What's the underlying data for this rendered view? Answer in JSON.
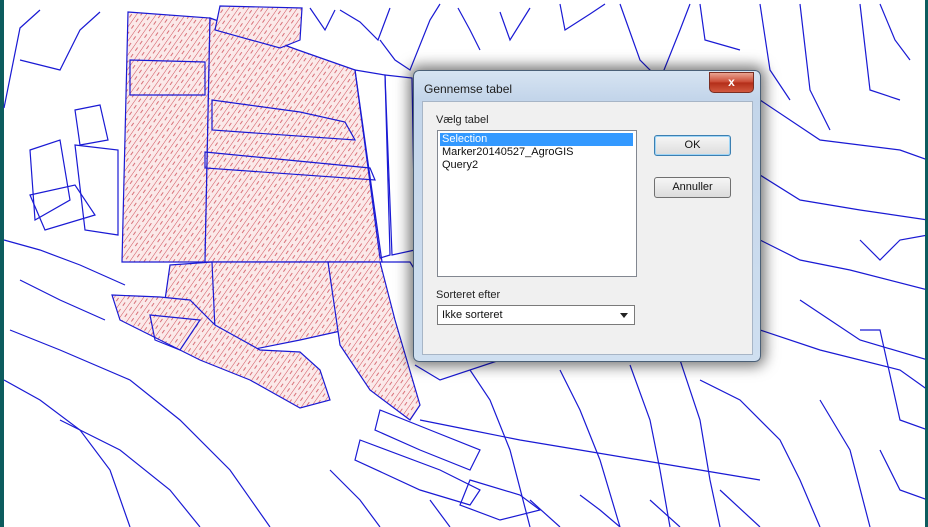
{
  "dialog": {
    "title": "Gennemse tabel",
    "close_glyph": "x",
    "table_label": "Vælg tabel",
    "tables": [
      {
        "label": "Selection",
        "selected": true
      },
      {
        "label": "Marker20140527_AgroGIS",
        "selected": false
      },
      {
        "label": "Query2",
        "selected": false
      }
    ],
    "ok_label": "OK",
    "cancel_label": "Annuller",
    "sort_label": "Sorteret efter",
    "sort_value": "Ikke sorteret"
  },
  "colors": {
    "parcel_line": "#1a1ad4",
    "selection_hatch": "#d0505a",
    "selection_fill": "#fbe3e3",
    "listbox_selected": "#3399ff"
  }
}
